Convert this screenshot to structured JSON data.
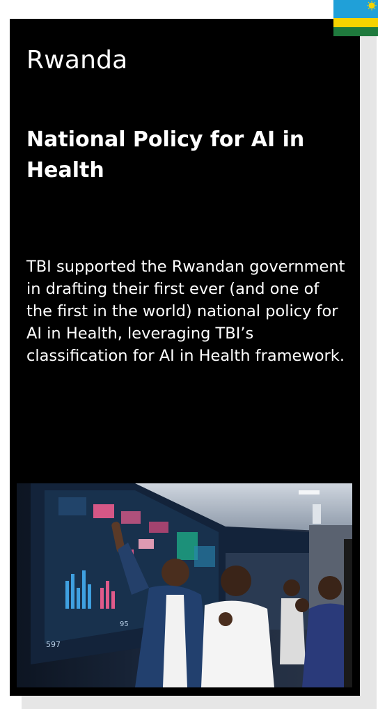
{
  "slide": {
    "country": "Rwanda",
    "policy_title": "National Policy for AI in Health",
    "description": "TBI supported the Rwandan government in drafting their first ever (and one of the first in the world) national policy for AI in Health, leveraging TBI’s classification for AI in Health framework.",
    "photo_caption_numbers": [
      "597",
      "95"
    ]
  },
  "flag": {
    "name": "rwanda-flag",
    "colors": {
      "blue": "#20a0d8",
      "yellow": "#f6d300",
      "green": "#1f7a3d",
      "sun": "#f6d300"
    }
  },
  "colors": {
    "card_background": "#000000",
    "text": "#ffffff",
    "shadow": "#e6e6e6"
  }
}
